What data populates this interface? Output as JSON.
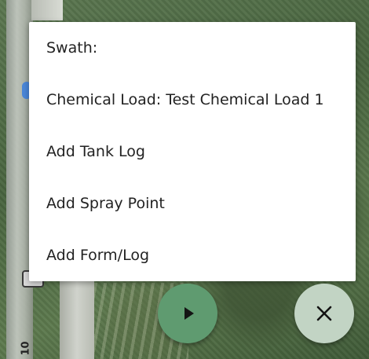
{
  "menu": {
    "items": [
      {
        "label": "Swath:"
      },
      {
        "label": "Chemical Load: Test Chemical Load 1"
      },
      {
        "label": "Add Tank Log"
      },
      {
        "label": "Add Spray Point"
      },
      {
        "label": "Add Form/Log"
      }
    ]
  },
  "map": {
    "route_label": "10"
  },
  "fabs": {
    "play_icon": "play-icon",
    "close_icon": "close-icon",
    "play_color": "#5f9b70",
    "close_color": "#c2d4c4"
  }
}
